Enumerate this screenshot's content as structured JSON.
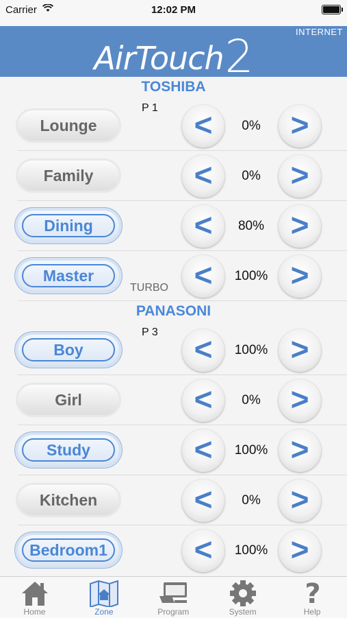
{
  "status_bar": {
    "carrier": "Carrier",
    "time": "12:02 PM"
  },
  "header": {
    "logo_text": "AirTouch",
    "logo_number": "2",
    "connection": "INTERNET"
  },
  "groups": [
    {
      "name": "TOSHIBA",
      "zones": [
        {
          "name": "Lounge",
          "active": false,
          "percent": "0%",
          "tag": "P 1"
        },
        {
          "name": "Family",
          "active": false,
          "percent": "0%"
        },
        {
          "name": "Dining",
          "active": true,
          "percent": "80%"
        },
        {
          "name": "Master",
          "active": true,
          "percent": "100%",
          "tag": "TURBO"
        }
      ]
    },
    {
      "name": "PANASONI",
      "zones": [
        {
          "name": "Boy",
          "active": true,
          "percent": "100%",
          "tag": "P 3"
        },
        {
          "name": "Girl",
          "active": false,
          "percent": "0%"
        },
        {
          "name": "Study",
          "active": true,
          "percent": "100%"
        },
        {
          "name": "Kitchen",
          "active": false,
          "percent": "0%"
        },
        {
          "name": "Bedroom1",
          "active": true,
          "percent": "100%"
        }
      ]
    }
  ],
  "controls": {
    "decrease_glyph": "<",
    "increase_glyph": ">"
  },
  "tabs": [
    {
      "label": "Home",
      "icon": "home-icon",
      "active": false
    },
    {
      "label": "Zone",
      "icon": "zone-map-icon",
      "active": true
    },
    {
      "label": "Program",
      "icon": "program-icon",
      "active": false
    },
    {
      "label": "System",
      "icon": "gear-icon",
      "active": false
    },
    {
      "label": "Help",
      "icon": "help-icon",
      "active": false
    }
  ],
  "colors": {
    "accent": "#4a86d6",
    "header": "#5a8ac6",
    "inactive_text": "#666666"
  }
}
